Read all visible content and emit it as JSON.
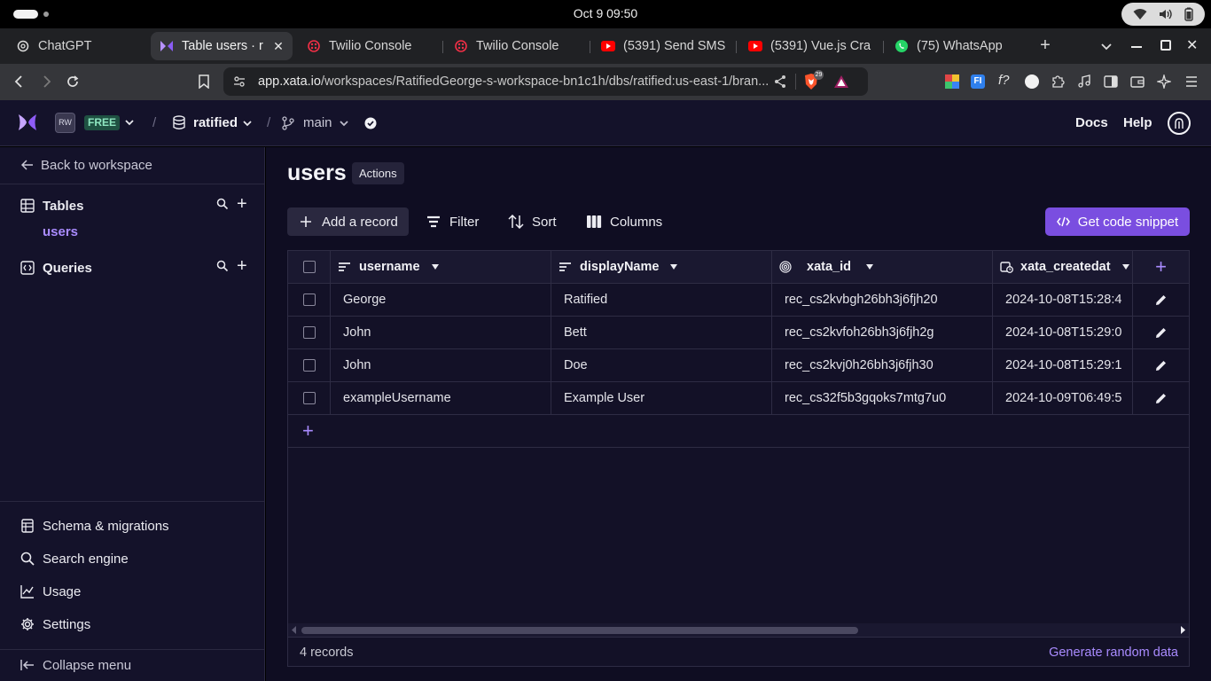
{
  "os": {
    "clock": "Oct 9  09:50"
  },
  "tabs": [
    {
      "label": "ChatGPT",
      "icon": "chatgpt-icon"
    },
    {
      "label": "Table users · r",
      "icon": "xata-icon",
      "active": true
    },
    {
      "label": "Twilio Console",
      "icon": "twilio-icon"
    },
    {
      "label": "Twilio Console",
      "icon": "twilio-icon"
    },
    {
      "label": "(5391) Send SMS",
      "icon": "youtube-icon"
    },
    {
      "label": "(5391) Vue.js Cra",
      "icon": "youtube-icon"
    },
    {
      "label": "(75) WhatsApp",
      "icon": "whatsapp-icon"
    }
  ],
  "browser": {
    "url_host": "app.xata.io",
    "url_path": "/workspaces/RatifiedGeorge-s-workspace-bn1c1h/dbs/ratified:us-east-1/bran...",
    "brave_badge": "29"
  },
  "header": {
    "workspace_initials": "RW",
    "plan": "FREE",
    "database": "ratified",
    "branch": "main",
    "docs": "Docs",
    "help": "Help"
  },
  "sidebar": {
    "back": "Back to workspace",
    "tables_label": "Tables",
    "table_item": "users",
    "queries_label": "Queries",
    "bottom": [
      {
        "label": "Schema & migrations",
        "icon": "schema-icon"
      },
      {
        "label": "Search engine",
        "icon": "search-engine-icon"
      },
      {
        "label": "Usage",
        "icon": "usage-chart-icon"
      },
      {
        "label": "Settings",
        "icon": "gear-icon"
      }
    ],
    "collapse": "Collapse menu"
  },
  "main": {
    "title": "users",
    "actions": "Actions",
    "toolbar": {
      "add_record": "Add a record",
      "filter": "Filter",
      "sort": "Sort",
      "columns": "Columns",
      "snippet": "Get code snippet"
    },
    "columns": [
      "username",
      "displayName",
      "xata_id",
      "xata_createdat"
    ],
    "rows": [
      [
        "George",
        "Ratified",
        "rec_cs2kvbgh26bh3j6fjh20",
        "2024-10-08T15:28:4"
      ],
      [
        "John",
        "Bett",
        "rec_cs2kvfoh26bh3j6fjh2g",
        "2024-10-08T15:29:0"
      ],
      [
        "John",
        "Doe",
        "rec_cs2kvj0h26bh3j6fjh30",
        "2024-10-08T15:29:1"
      ],
      [
        "exampleUsername",
        "Example User",
        "rec_cs32f5b3gqoks7mtg7u0",
        "2024-10-09T06:49:5"
      ]
    ],
    "record_count": "4 records",
    "generate": "Generate random data"
  },
  "colors": {
    "accent": "#7a4ee0",
    "link": "#a98bff",
    "sidebar_bg": "#14122a",
    "main_bg": "#0f0d22"
  }
}
